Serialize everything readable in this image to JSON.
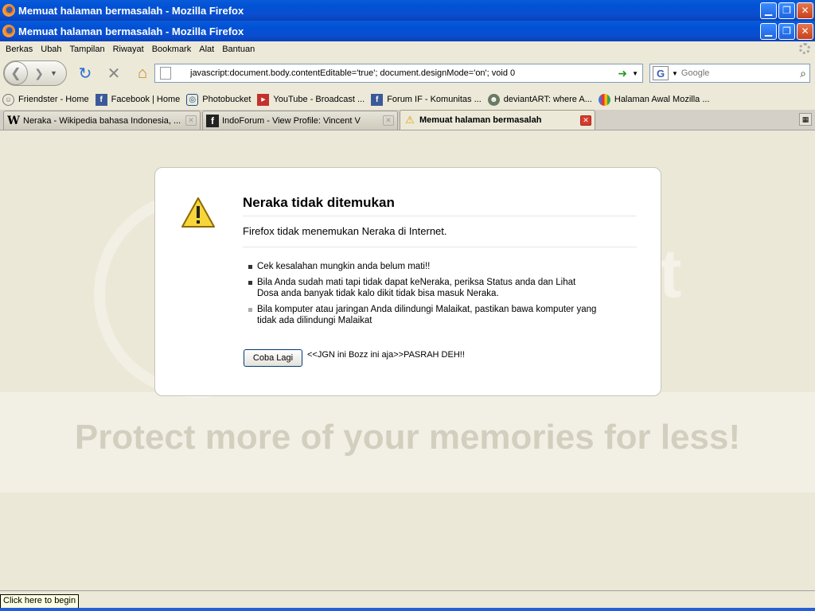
{
  "window": {
    "title1": "Memuat halaman bermasalah - Mozilla Firefox",
    "title2": "Memuat halaman bermasalah - Mozilla Firefox",
    "min": "▁",
    "max": "❐",
    "close": "✕"
  },
  "menu": [
    "Berkas",
    "Ubah",
    "Tampilan",
    "Riwayat",
    "Bookmark",
    "Alat",
    "Bantuan"
  ],
  "nav": {
    "url": "javascript:document.body.contentEditable='true'; document.designMode='on'; void 0",
    "search_placeholder": "Google"
  },
  "bookmarks": [
    {
      "label": "Friendster - Home",
      "icon": "friendster-icon"
    },
    {
      "label": "Facebook | Home",
      "icon": "facebook-icon"
    },
    {
      "label": "Photobucket",
      "icon": "photobucket-icon"
    },
    {
      "label": "YouTube - Broadcast ...",
      "icon": "youtube-icon"
    },
    {
      "label": "Forum IF - Komunitas ...",
      "icon": "facebook-icon"
    },
    {
      "label": "deviantART: where A...",
      "icon": "deviantart-icon"
    },
    {
      "label": "Halaman Awal Mozilla ...",
      "icon": "google-icon"
    }
  ],
  "tabs": [
    {
      "label": "Neraka - Wikipedia bahasa Indonesia, ...",
      "icon": "wikipedia-icon"
    },
    {
      "label": "IndoForum - View Profile: Vincent V",
      "icon": "facebook-icon"
    },
    {
      "label": "Memuat halaman bermasalah",
      "icon": "warning-icon"
    }
  ],
  "error": {
    "title": "Neraka tidak ditemukan",
    "short": "Firefox tidak menemukan Neraka di Internet.",
    "items": [
      "Cek kesalahan mungkin anda belum mati!!",
      "Bila Anda sudah mati tapi tidak dapat keNeraka, periksa Status anda dan Lihat Dosa anda banyak tidak kalo dikit tidak bisa masuk Neraka.",
      "Bila komputer atau jaringan Anda dilindungi Malaikat, pastikan bawa komputer yang tidak ada dilindungi Malaikat"
    ],
    "retry": "Coba Lagi",
    "note": "<<JGN ini Bozz ini aja>>PASRAH DEH!!"
  },
  "watermark": {
    "band_text": "Protect more of your memories for less!",
    "side_text": "et"
  },
  "status": {
    "text": "Click here to begin"
  }
}
